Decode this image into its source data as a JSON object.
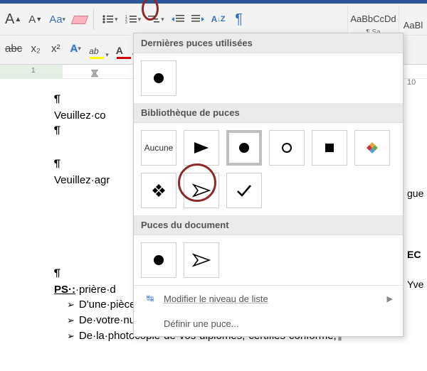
{
  "ribbon": {
    "grow_font": "A",
    "shrink_font": "A",
    "change_case": "Aa",
    "clear_format": "eraser",
    "bullets_icon": "bulleted-list",
    "numbering_icon": "numbered-list",
    "multilist_icon": "multilevel-list",
    "indent_dec": "decrease-indent",
    "indent_inc": "increase-indent",
    "sort": "A↓Z",
    "show_marks": "¶",
    "strike": "abc",
    "sub": "x₂",
    "sup": "x²",
    "text_effects": "A",
    "highlight_color": "#ffff00",
    "font_color": "#d00000"
  },
  "styles": {
    "normal": "AaBbCcDd",
    "nospace": "AaBl",
    "label1": "¶ Sa"
  },
  "ruler": {
    "n1": "1",
    "right10": "10"
  },
  "document": {
    "p1": "¶",
    "l1": "Veuillez·co",
    "p2": "¶",
    "p3": "¶",
    "l2": "Veuillez·agr",
    "p4": "¶",
    "ps_label": "PS·:",
    "ps_rest": "·prière·d",
    "li1": "D'une·pièce·d'identité,¶",
    "li2": "De·votre·numéro·national·de·sécurité·sociale,¶",
    "li3": "De·la·photocopie·de·vos·diplômes,·certifies·conforme,¶"
  },
  "dropdown": {
    "recent_h": "Dernières puces utilisées",
    "library_h": "Bibliothèque de puces",
    "docbul_h": "Puces du document",
    "none_label": "Aucune",
    "change_level": "Modifier le niveau de liste",
    "define_bullet": "Définir une puce..."
  },
  "partial": {
    "r1": "10",
    "r2": "gue",
    "r3": "EC",
    "r4": "Yve"
  }
}
